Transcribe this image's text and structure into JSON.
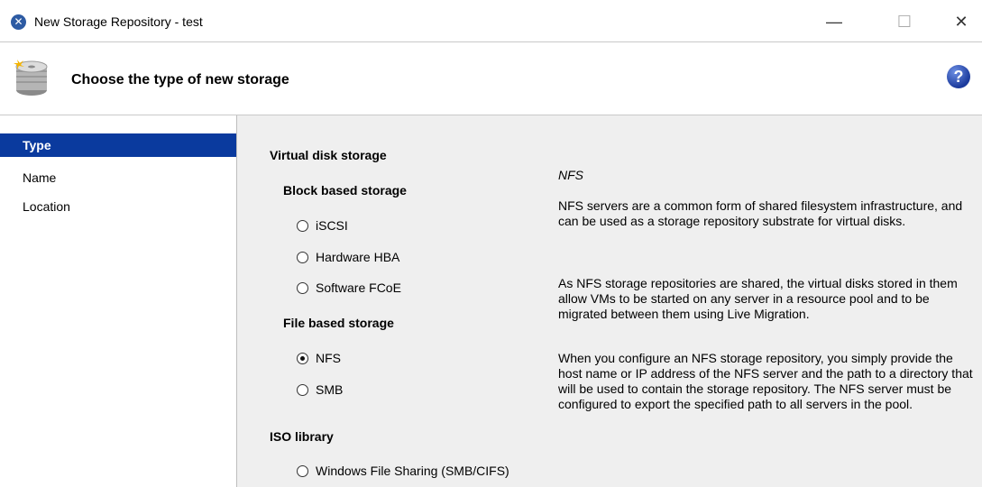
{
  "window": {
    "title": "New Storage Repository - test",
    "min_glyph": "—",
    "max_glyph": "☐",
    "close_glyph": "✕"
  },
  "header": {
    "title": "Choose the type of new storage",
    "help_glyph": "?"
  },
  "sidebar": {
    "items": [
      {
        "label": "Type",
        "selected": true
      },
      {
        "label": "Name",
        "selected": false
      },
      {
        "label": "Location",
        "selected": false
      }
    ]
  },
  "options": {
    "virtual_disk_label": "Virtual disk storage",
    "block_label": "Block based storage",
    "file_label": "File based storage",
    "iso_label": "ISO library",
    "iscsi": "iSCSI",
    "hba": "Hardware HBA",
    "fcoe": "Software FCoE",
    "nfs": "NFS",
    "smb": "SMB",
    "windows_file_sharing": "Windows File Sharing (SMB/CIFS)",
    "selected": "NFS"
  },
  "description": {
    "title": "NFS",
    "p1": "NFS servers are a common form of shared filesystem infrastructure, and can be used as a storage repository substrate for virtual disks.",
    "p2": "As NFS storage repositories are shared, the virtual disks stored in them allow VMs to be started on any server in a resource pool and to be migrated between them using Live Migration.",
    "p3": "When you configure an NFS storage repository, you simply provide the host name or IP address of the NFS server and the path to a directory that will be used to contain the storage repository. The NFS server must be configured to export the specified path to all servers in the pool."
  },
  "colors": {
    "selection": "#0a3a9e",
    "panel": "#efefef"
  }
}
